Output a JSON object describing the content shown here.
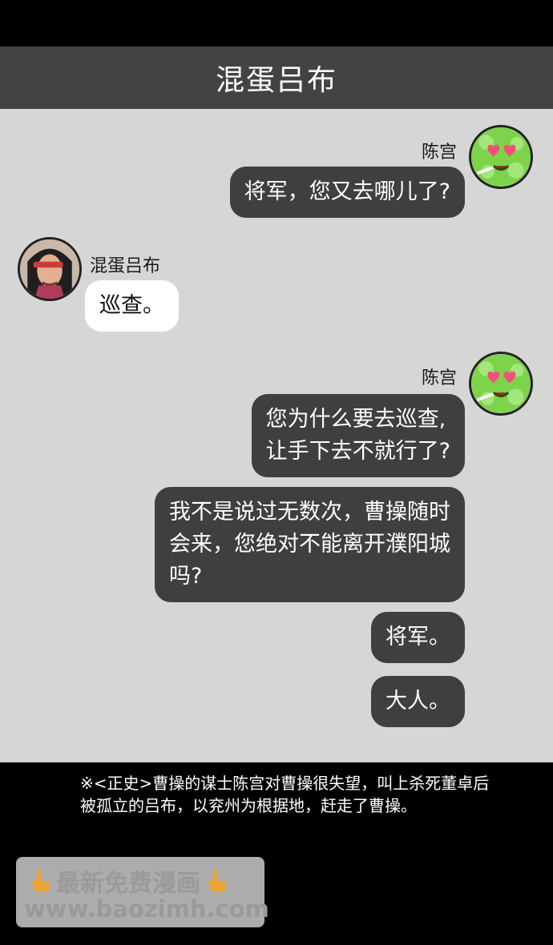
{
  "header": {
    "title": "混蛋吕布"
  },
  "messages": [
    {
      "sender": "陈宫",
      "text": "将军，您又去哪儿了?"
    },
    {
      "sender": "混蛋吕布",
      "text": "巡查。"
    },
    {
      "sender": "陈宫",
      "lines": [
        "您为什么要去巡查,",
        "让手下去不就行了?"
      ]
    },
    {
      "lines": [
        "我不是说过无数次，曹操随时",
        "会来，您绝对不能离开濮阳城",
        "吗?"
      ]
    },
    {
      "text": "将军。"
    },
    {
      "text": "大人。"
    }
  ],
  "footnote": {
    "line1": "※<正史>曹操的谋士陈宫对曹操很失望，叫上杀死董卓后",
    "line2": "被孤立的吕布，以兖州为根据地，赶走了曹操。"
  },
  "watermark": {
    "line1": "最新免费漫画",
    "line2": "www.baozimh.com"
  },
  "colors": {
    "header_bg": "#434343",
    "chat_bg": "#d6d6d6",
    "bubble_dark": "#3f3f3f",
    "bubble_light": "#ffffff",
    "avatar_green": "#7dd34a"
  }
}
